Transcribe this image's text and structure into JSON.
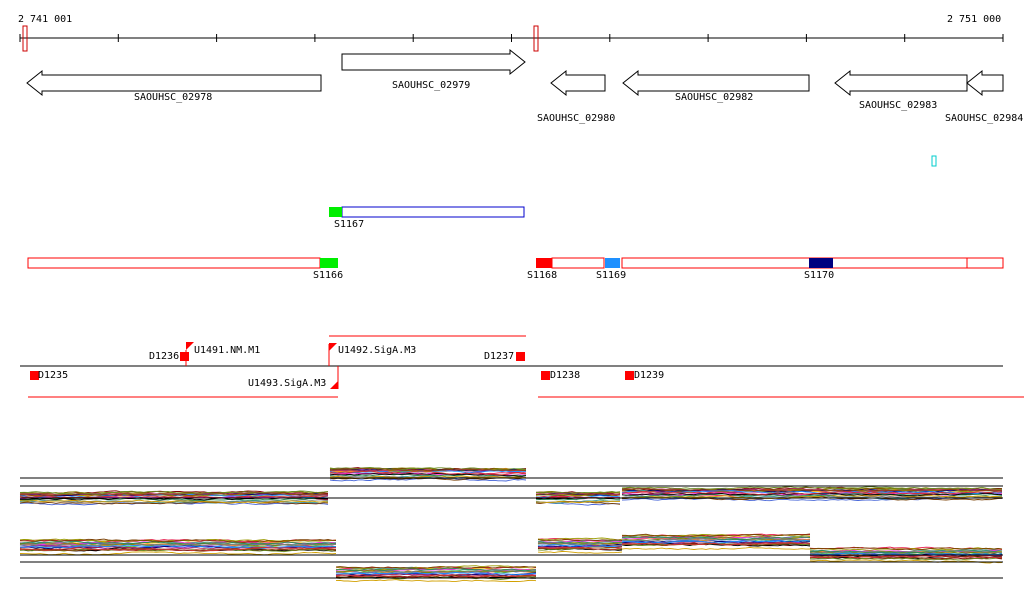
{
  "ruler": {
    "start_label": "2 741 001",
    "end_label": "2 751 000"
  },
  "genes": [
    {
      "id": "SAOUHSC_02978",
      "strand": "-"
    },
    {
      "id": "SAOUHSC_02979",
      "strand": "+"
    },
    {
      "id": "SAOUHSC_02980",
      "strand": "-"
    },
    {
      "id": "SAOUHSC_02982",
      "strand": "-"
    },
    {
      "id": "SAOUHSC_02983",
      "strand": "-"
    },
    {
      "id": "SAOUHSC_02984",
      "strand": "-"
    }
  ],
  "segments": {
    "s1167": "S1167",
    "s1166": "S1166",
    "s1168": "S1168",
    "s1169": "S1169",
    "s1170": "S1170"
  },
  "features": {
    "d1235": "D1235",
    "d1236": "D1236",
    "u1491": "U1491.NM.M1",
    "u1492": "U1492.SigA.M3",
    "u1493": "U1493.SigA.M3",
    "d1237": "D1237",
    "d1238": "D1238",
    "d1239": "D1239"
  },
  "colors": {
    "red": "#ff0000",
    "green": "#00ee00",
    "lightblue": "#1e90ff",
    "navy": "#000080",
    "blue_outline": "#0000cc",
    "cyan": "#00cccc"
  }
}
